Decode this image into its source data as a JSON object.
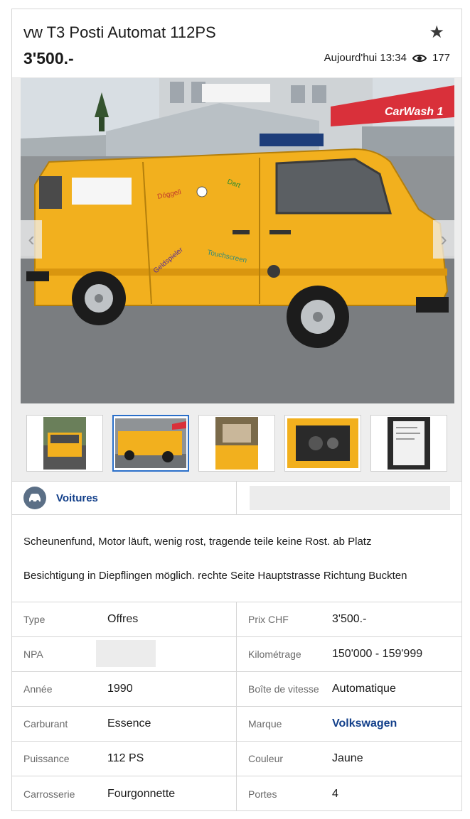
{
  "listing": {
    "title": "vw T3 Posti Automat 112PS",
    "price": "3'500.-",
    "posted": "Aujourd'hui 13:34",
    "views": "177"
  },
  "photo": {
    "signs": {
      "carwash": "CarWash 1"
    },
    "van_decals": [
      "Döggeli",
      "Dart",
      "Geldspieler",
      "Touchscreen"
    ],
    "thumbnails": [
      "front view",
      "side view",
      "interior",
      "engine",
      "document"
    ],
    "active_thumbnail_index": 1
  },
  "category": {
    "label": "Voitures",
    "icon": "car-icon"
  },
  "description": {
    "p1": "Scheunenfund, Motor läuft, wenig rost, tragende teile keine Rost. ab Platz",
    "p2": "Besichtigung in Diepflingen möglich. rechte Seite Hauptstrasse Richtung Buckten"
  },
  "specs": [
    {
      "left": {
        "label": "Type",
        "value": "Offres"
      },
      "right": {
        "label": "Prix CHF",
        "value": "3'500.-"
      }
    },
    {
      "left": {
        "label": "NPA",
        "value": ""
      },
      "right": {
        "label": "Kilométrage",
        "value": "150'000 - 159'999"
      }
    },
    {
      "left": {
        "label": "Année",
        "value": "1990"
      },
      "right": {
        "label": "Boîte de vitesse",
        "value": "Automatique"
      }
    },
    {
      "left": {
        "label": "Carburant",
        "value": "Essence"
      },
      "right": {
        "label": "Marque",
        "value": "Volkswagen"
      }
    },
    {
      "left": {
        "label": "Puissance",
        "value": "112 PS"
      },
      "right": {
        "label": "Couleur",
        "value": "Jaune"
      }
    },
    {
      "left": {
        "label": "Carrosserie",
        "value": "Fourgonnette"
      },
      "right": {
        "label": "Portes",
        "value": "4"
      }
    }
  ],
  "colors": {
    "accent_link": "#123f8a",
    "van_yellow": "#f2b01e",
    "active_border": "#2a6fc9"
  }
}
